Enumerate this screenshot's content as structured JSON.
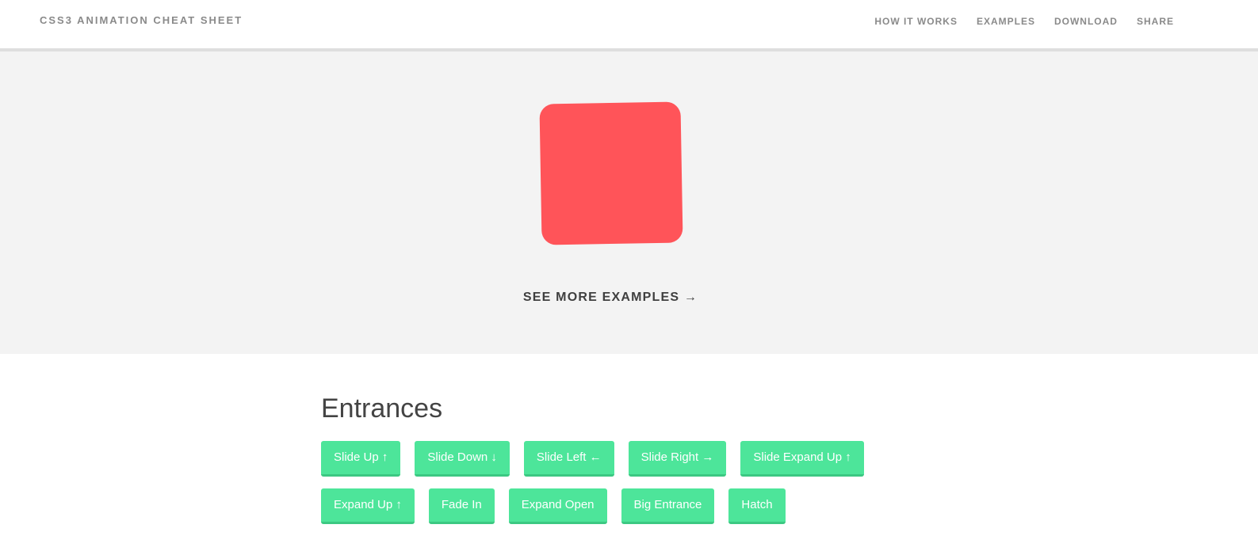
{
  "header": {
    "title": "CSS3 ANIMATION CHEAT SHEET",
    "nav": [
      "HOW IT WORKS",
      "EXAMPLES",
      "DOWNLOAD",
      "SHARE"
    ]
  },
  "hero": {
    "demo_color": "#ff5459",
    "see_more": "SEE MORE EXAMPLES →"
  },
  "entrances": {
    "title": "Entrances",
    "row1": [
      "Slide Up ↑",
      "Slide Down ↓",
      "Slide Left ←",
      "Slide Right →",
      "Slide Expand Up ↑"
    ],
    "row2": [
      "Expand Up ↑",
      "Fade In",
      "Expand Open",
      "Big Entrance",
      "Hatch"
    ]
  },
  "colors": {
    "button": "#4de59a",
    "hero_bg": "#f3f3f3"
  }
}
